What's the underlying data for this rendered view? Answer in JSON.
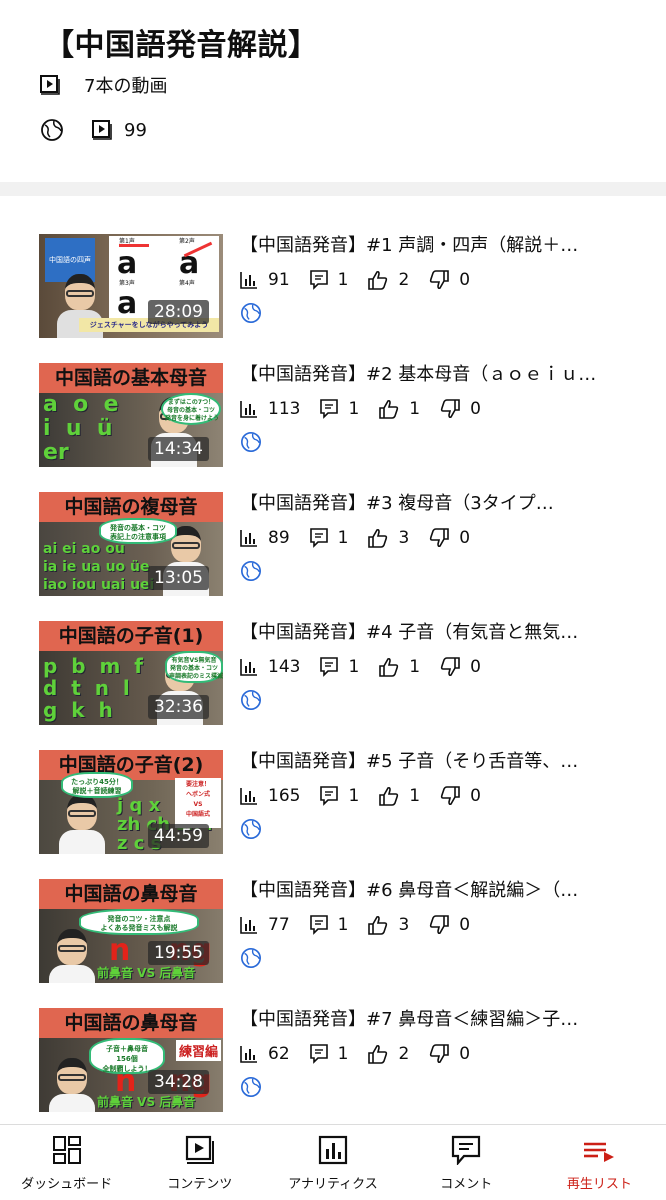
{
  "playlist": {
    "title": "【中国語発音解説】",
    "video_count": "7本の動画",
    "views": "99"
  },
  "videos": [
    {
      "title": "【中国語発音】#1 声調・四声（解説＋…",
      "views": "91",
      "comments": "1",
      "likes": "2",
      "dislikes": "0",
      "duration": "28:09",
      "thumb_title": ""
    },
    {
      "title": "【中国語発音】#2 基本母音（ａｏｅｉｕ…",
      "views": "113",
      "comments": "1",
      "likes": "1",
      "dislikes": "0",
      "duration": "14:34",
      "thumb_title": "中国語の基本母音"
    },
    {
      "title": "【中国語発音】#3 複母音（3タイプ…",
      "views": "89",
      "comments": "1",
      "likes": "3",
      "dislikes": "0",
      "duration": "13:05",
      "thumb_title": "中国語の複母音"
    },
    {
      "title": "【中国語発音】#4 子音（有気音と無気…",
      "views": "143",
      "comments": "1",
      "likes": "1",
      "dislikes": "0",
      "duration": "32:36",
      "thumb_title": "中国語の子音(1)"
    },
    {
      "title": "【中国語発音】#5 子音（そり舌音等、…",
      "views": "165",
      "comments": "1",
      "likes": "1",
      "dislikes": "0",
      "duration": "44:59",
      "thumb_title": "中国語の子音(2)"
    },
    {
      "title": "【中国語発音】#6 鼻母音＜解説編＞（…",
      "views": "77",
      "comments": "1",
      "likes": "3",
      "dislikes": "0",
      "duration": "19:55",
      "thumb_title": "中国語の鼻母音"
    },
    {
      "title": "【中国語発音】#7 鼻母音＜練習編＞子…",
      "views": "62",
      "comments": "1",
      "likes": "2",
      "dislikes": "0",
      "duration": "34:28",
      "thumb_title": "中国語の鼻母音"
    }
  ],
  "thumb_text": {
    "v1_band": "中国語の四声",
    "v1_tone1": "第1声",
    "v1_tone2": "第2声",
    "v1_tone3": "第3声",
    "v1_tone4": "第4声",
    "v1_caption": "ジェスチャーをしながらやってみよう",
    "v2_letters": "a  o  e\ni  u  ü\ner",
    "v2_bubble": "まずはこの7つ！\n母音の基本・コツ\n発音を身に着けよう",
    "v3_letters": "ai ei ao ou\nia ie ua uo üe\niao iou uai uei",
    "v3_bubble": "発音の基本・コツ\n表記上の注意事項",
    "v4_letters": "p  b  m  f\nd  t  n  l\ng  k  h",
    "v4_bubble": "有気音VS無気音\n発音の基本・コツ\n声調表記のミス撲滅",
    "v5_letters": "j q x\nzh ch sh r\nz c s",
    "v5_bubble": "たっぷり45分！\n解説＋音読練習",
    "v5_note": "要注意！\nヘボン式\nVS\n中国語式",
    "v6_bubble": "発音のコツ・注意点\nよくある発音ミスも解説",
    "v6_n": "n",
    "v6_ng": "ng",
    "v6_caption": "前鼻音 VS 后鼻音",
    "v7_bubble": "子音＋鼻母音\n156個\n全制覇しよう！",
    "v7_badge": "練習編",
    "v7_n": "n",
    "v7_ng": "ng",
    "v7_caption": "前鼻音 VS 后鼻音"
  },
  "nav": {
    "dashboard": "ダッシュボード",
    "contents": "コンテンツ",
    "analytics": "アナリティクス",
    "comments": "コメント",
    "playlists": "再生リスト"
  },
  "colors": {
    "accent": "#cc1f16",
    "band": "#e06650",
    "green_text": "#5fd13a"
  }
}
